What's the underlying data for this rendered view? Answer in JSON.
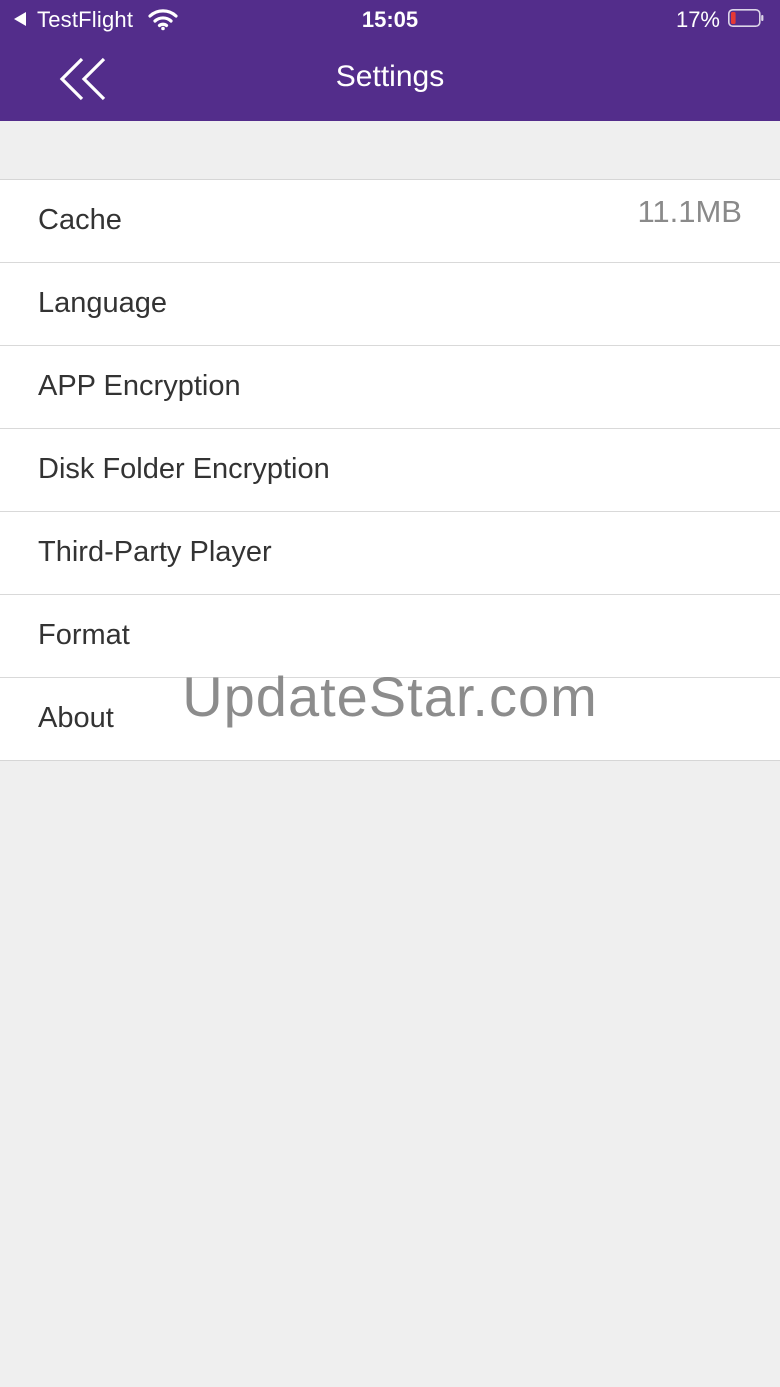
{
  "status_bar": {
    "carrier": "TestFlight",
    "time": "15:05",
    "battery_percent": "17%",
    "battery_level": 0.17,
    "icons": [
      "back-triangle-icon",
      "wifi-icon",
      "battery-icon"
    ]
  },
  "nav": {
    "title": "Settings",
    "back_icon": "double-chevron-left-icon"
  },
  "settings": {
    "items": [
      {
        "label": "Cache",
        "value": "11.1MB"
      },
      {
        "label": "Language"
      },
      {
        "label": "APP Encryption"
      },
      {
        "label": "Disk Folder Encryption"
      },
      {
        "label": "Third-Party Player"
      },
      {
        "label": "Format"
      },
      {
        "label": "About"
      }
    ]
  },
  "watermark": "UpdateStar.com",
  "colors": {
    "header": "#532d8b",
    "background": "#efefef",
    "battery_low": "#e53935"
  }
}
